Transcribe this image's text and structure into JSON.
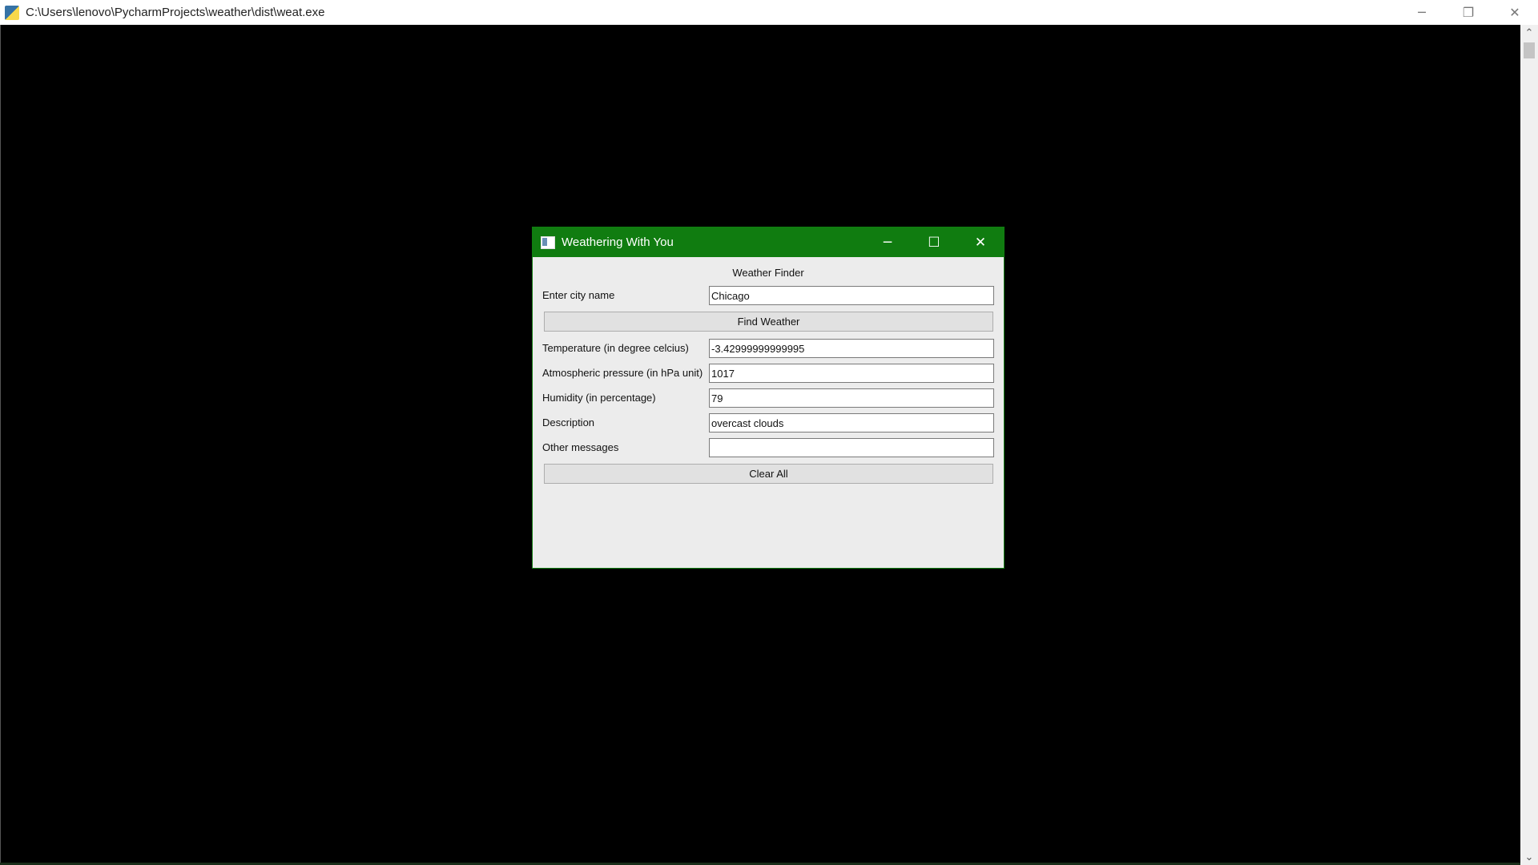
{
  "console_window": {
    "title": "C:\\Users\\lenovo\\PycharmProjects\\weather\\dist\\weat.exe",
    "controls": {
      "minimize": "─",
      "restore": "❐",
      "close": "✕"
    }
  },
  "app_window": {
    "title": "Weathering With You",
    "controls": {
      "minimize": "─",
      "maximize": "☐",
      "close": "✕"
    },
    "accent_color": "#107c10",
    "heading": "Weather Finder",
    "city": {
      "label": "Enter city name",
      "value": "Chicago"
    },
    "find_button": "Find Weather",
    "temperature": {
      "label": "Temperature (in degree celcius)",
      "value": "-3.42999999999995"
    },
    "pressure": {
      "label": "Atmospheric pressure (in hPa unit)",
      "value": "1017"
    },
    "humidity": {
      "label": "Humidity (in percentage)",
      "value": "79"
    },
    "description": {
      "label": "Description",
      "value": "overcast clouds"
    },
    "other_messages": {
      "label": "Other messages",
      "value": ""
    },
    "clear_button": "Clear All"
  },
  "scrollbar": {
    "up_arrow": "⌃",
    "down_arrow": "⌄"
  }
}
